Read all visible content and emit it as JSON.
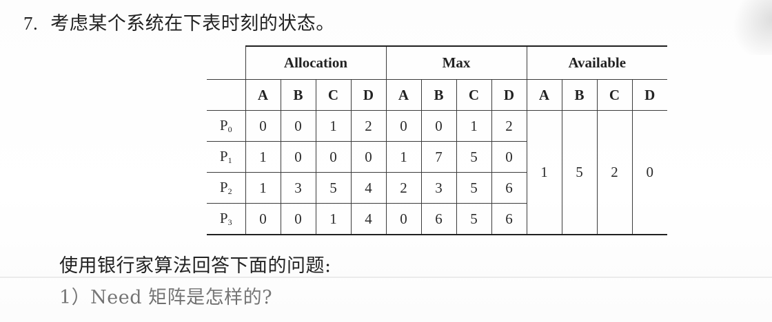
{
  "question": {
    "number": "7.",
    "text": "考虑某个系统在下表时刻的状态。"
  },
  "table": {
    "groups": [
      "Allocation",
      "Max",
      "Available"
    ],
    "letters": [
      "A",
      "B",
      "C",
      "D",
      "A",
      "B",
      "C",
      "D",
      "A",
      "B",
      "C",
      "D"
    ],
    "rows": [
      {
        "process": "P",
        "sub": "0",
        "allocation": [
          "0",
          "0",
          "1",
          "2"
        ],
        "max": [
          "0",
          "0",
          "1",
          "2"
        ]
      },
      {
        "process": "P",
        "sub": "1",
        "allocation": [
          "1",
          "0",
          "0",
          "0"
        ],
        "max": [
          "1",
          "7",
          "5",
          "0"
        ]
      },
      {
        "process": "P",
        "sub": "2",
        "allocation": [
          "1",
          "3",
          "5",
          "4"
        ],
        "max": [
          "2",
          "3",
          "5",
          "6"
        ]
      },
      {
        "process": "P",
        "sub": "3",
        "allocation": [
          "0",
          "0",
          "1",
          "4"
        ],
        "max": [
          "0",
          "6",
          "5",
          "6"
        ]
      }
    ],
    "available": [
      "1",
      "5",
      "2",
      "0"
    ]
  },
  "footer": {
    "line1": "使用银行家算法回答下面的问题:",
    "line2": "1）Need 矩阵是怎样的?"
  }
}
